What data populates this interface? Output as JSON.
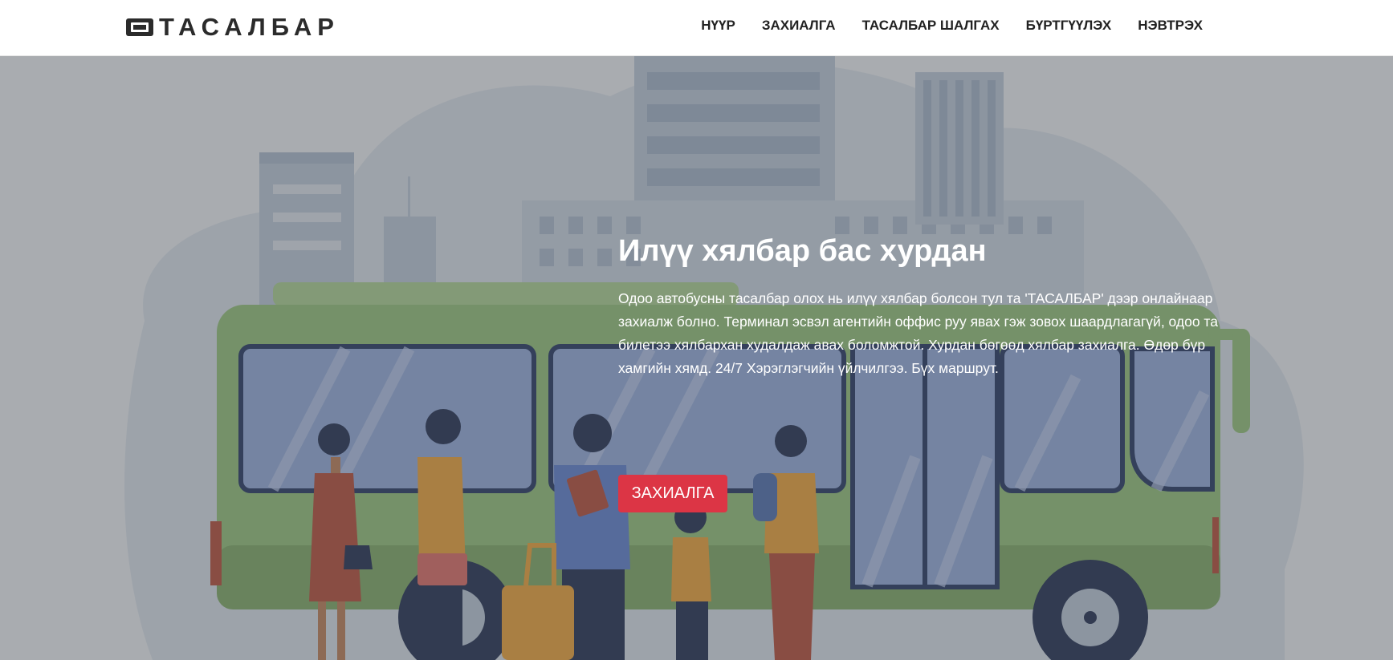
{
  "brand": {
    "name": "ТАСАЛБАР",
    "icon": "ticket-icon"
  },
  "nav": {
    "items": [
      {
        "label": "НҮҮР"
      },
      {
        "label": "ЗАХИАЛГА"
      },
      {
        "label": "ТАСАЛБАР ШАЛГАХ"
      },
      {
        "label": "БҮРТГҮҮЛЭХ"
      },
      {
        "label": "НЭВТРЭХ"
      }
    ]
  },
  "hero": {
    "title": "Илүү хялбар бас хурдан",
    "text": "Одоо автобусны тасалбар олох нь илүү хялбар болсон тул та 'ТАСАЛБАР' дээр онлайнаар захиалж болно. Терминал эсвэл агентийн оффис руу явах гэж зовох шаардлагагүй, одоо та билетээ хялбархан худалдаж авах боломжтой. Хурдан бөгөөд хялбар захиалга. Өдөр бүр хамгийн хямд. 24/7 Хэрэглэгчийн үйлчилгээ. Бүх маршрут.",
    "cta_label": "ЗАХИАЛГА",
    "background": "bus-stop-illustration"
  },
  "colors": {
    "accent": "#dc3545",
    "bus_body": "#8fbf7a",
    "city": "#b7c6d9"
  }
}
